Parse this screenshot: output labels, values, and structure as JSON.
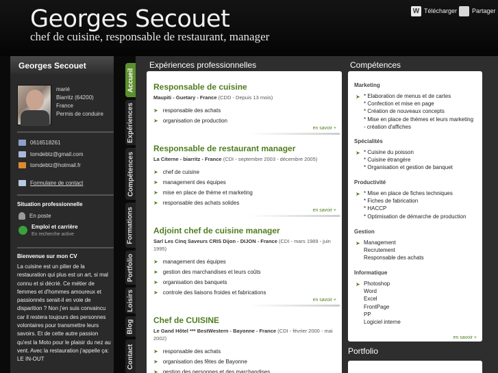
{
  "header": {
    "name": "Georges Secouet",
    "subtitle": "chef de cuisine, responsable de restaurant, manager",
    "download": "Télécharger",
    "share": "Partager"
  },
  "profile": {
    "title": "Georges Secouet",
    "info": [
      "marié",
      "Biarritz (64200)",
      "France",
      "Permis de conduire"
    ],
    "phone": "0616518261",
    "email1": "tomdebtz@gmail.com",
    "email2": "tomdebtz@hotmail.fr",
    "contact_form": "Formulaire de contact",
    "situation_title": "Situation professionnelle",
    "situation": "En poste",
    "employment_title": "Emploi et carrière",
    "employment_status": "En recherche active",
    "about_title": "Bienvenue sur mon CV",
    "about": "La cuisine est un pilier de la restauration qui plus est un art, si mal connu et si décrié. Ce métier de femmes et d'hommes amoureux et passionnés serait-il en voie de disparition ? Non j'en suis convaincu car il restera toujours des personnes volontaires pour transmettre leurs savoirs. Et de cette autre passion qu'est la Moto pour le plaisir du nez au vent. Avec la restauration j'appelle ça: LE IN-OUT"
  },
  "tabs": [
    "Accueil",
    "Expériences",
    "Compétences",
    "Formations",
    "Portfolio",
    "Loisirs",
    "Blog",
    "Contact"
  ],
  "experiences": {
    "heading": "Expériences professionnelles",
    "more": "en savoir +",
    "jobs": [
      {
        "title": "Responsable de cuisine",
        "company": "Maupiti - Guetary - France",
        "dates": "(CDD - Depuis 13 mois)",
        "items": [
          "responsable des achats",
          "organisation de production"
        ]
      },
      {
        "title": "Responsable de restaurant manager",
        "company": "La Citerne - biarritz - France",
        "dates": "(CDI - septembre 2003 - décembre 2005)",
        "items": [
          "chef de cuisine",
          "management des équipes",
          "mise en place de thème et marketing",
          "responsable des achats solides"
        ]
      },
      {
        "title": "Adjoint chef de cuisine manager",
        "company": "Sarl Les Cinq Saveurs CRIS Dijon - DIJON - France",
        "dates": "(CDI - mars 1989 - juin 1995)",
        "items": [
          "management des équipes",
          "gestion des marchandises et leurs coûts",
          "organisation des banquets",
          "controle des liaisons froides et fabrications"
        ]
      },
      {
        "title": "Chef de CUISINE",
        "company": "Le Gand Hôtel *** BestWestern - Bayonne - France",
        "dates": "(CDI - février 2000 - mai 2002)",
        "items": [
          "responsable des achats",
          "organisation des fêtes de Bayonne",
          "gestion des personnes et des marchandises"
        ]
      }
    ]
  },
  "competences": {
    "heading": "Compétences",
    "more": "en savoir +",
    "groups": [
      {
        "title": "Marketing",
        "items": [
          "* Elaboration de menus et de cartes",
          "* Confection et mise en page",
          "* Création de nouveaux concepts",
          "* Mise en place de thèmes et leurs marketing",
          "- création d'affiches"
        ]
      },
      {
        "title": "Spécialités",
        "items": [
          "* Cuisine du poisson",
          "* Cuisine étrangère",
          "* Organisation et gestion de banquet"
        ]
      },
      {
        "title": "Productivité",
        "items": [
          "* Mise en place de fiches techniques",
          "* Fiches de fabrication",
          "* HACCP",
          "* Optimisation de démarche de production"
        ]
      },
      {
        "title": "Gestion",
        "items": [
          "Management",
          "Recrutement",
          "Responsable des achats"
        ]
      },
      {
        "title": "Informatique",
        "items": [
          "Photoshop",
          "Word",
          "Excel",
          "FrontPage",
          "PP",
          "Logiciel interne"
        ]
      }
    ]
  },
  "portfolio": {
    "heading": "Portfolio"
  }
}
